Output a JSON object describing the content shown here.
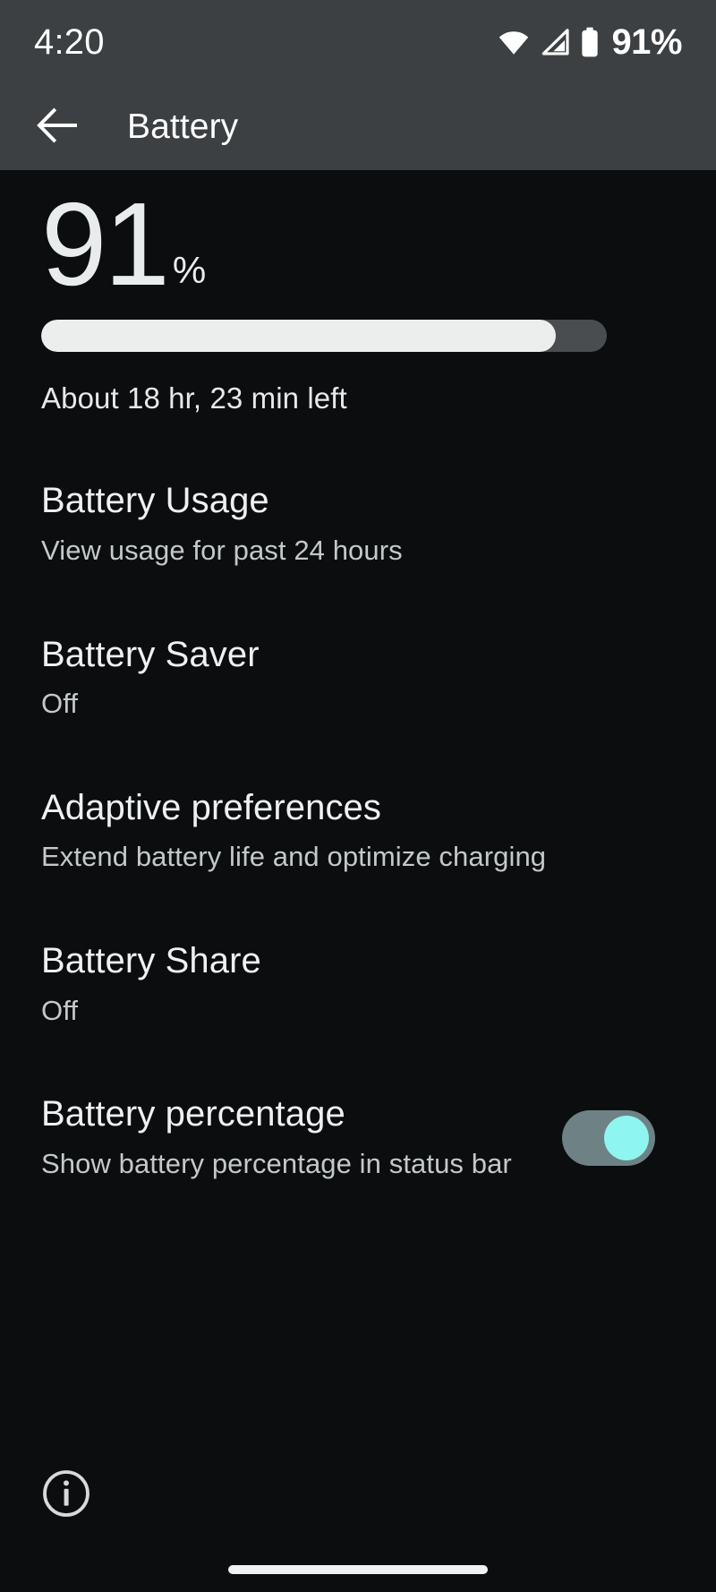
{
  "status_bar": {
    "time": "4:20",
    "battery_percent_label": "91%",
    "icons": [
      "wifi-icon",
      "cellular-signal-icon",
      "battery-icon"
    ]
  },
  "app_bar": {
    "back_icon": "back-arrow-icon",
    "title": "Battery"
  },
  "hero": {
    "level_number": "91",
    "percent_symbol": "%",
    "level_value": 91,
    "estimate": "About 18 hr, 23 min left"
  },
  "settings": [
    {
      "title": "Battery Usage",
      "summary": "View usage for past 24 hours",
      "control": "none"
    },
    {
      "title": "Battery Saver",
      "summary": "Off",
      "control": "none"
    },
    {
      "title": "Adaptive preferences",
      "summary": "Extend battery life and optimize charging",
      "control": "none"
    },
    {
      "title": "Battery Share",
      "summary": "Off",
      "control": "none"
    },
    {
      "title": "Battery percentage",
      "summary": "Show battery percentage in status bar",
      "control": "toggle",
      "toggle_state": "on"
    }
  ],
  "footer": {
    "info_icon": "info-icon",
    "nav_pill": "home-gesture-pill"
  },
  "colors": {
    "chrome_background": "#3c4043",
    "page_background": "#0b0d0e",
    "primary_text": "#eef1f2",
    "secondary_text": "#c3c8c9",
    "bar_fill": "#eceeee",
    "bar_track": "#4a4d4f",
    "toggle_track_on": "#6e8286",
    "toggle_thumb_on": "#8ff5f0"
  }
}
